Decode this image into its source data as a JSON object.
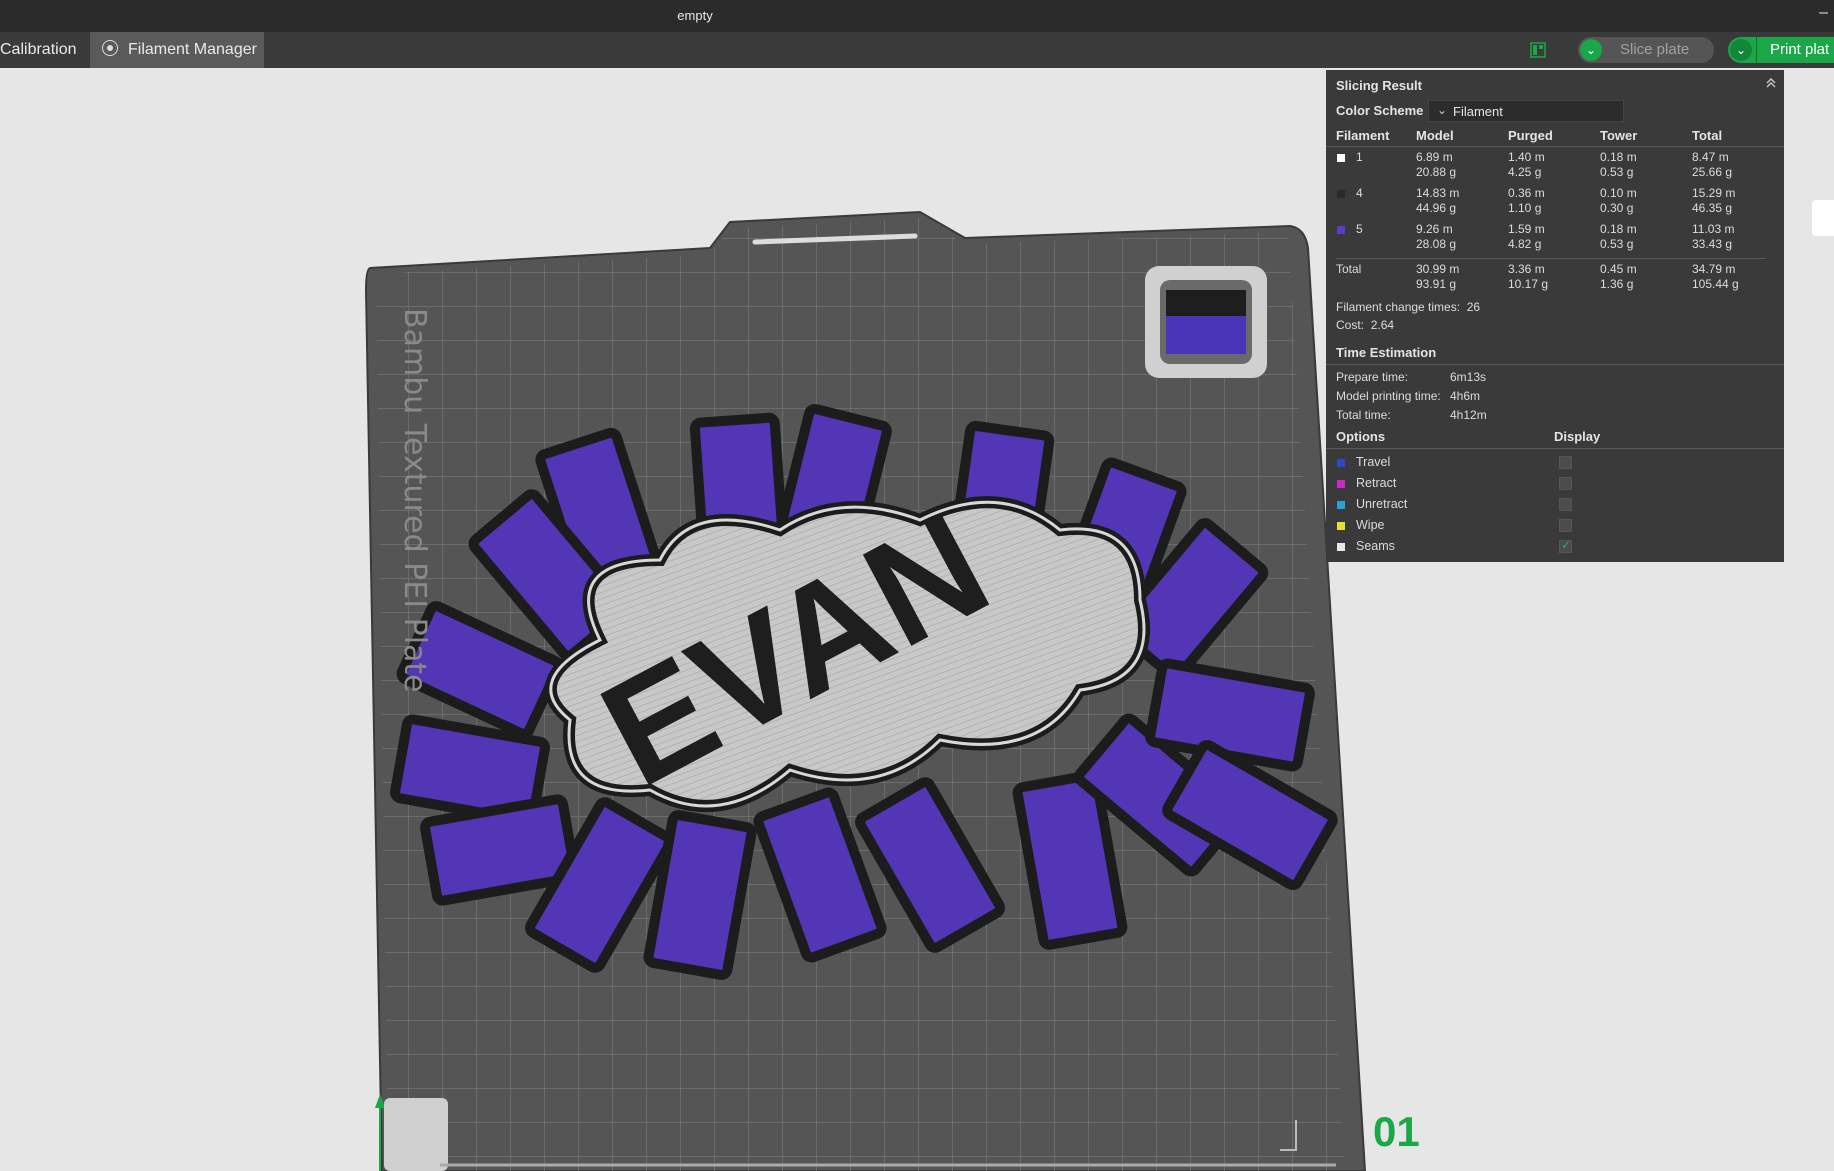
{
  "window": {
    "title": "empty"
  },
  "toolbar": {
    "calibration_label": "Calibration",
    "filament_manager_label": "Filament Manager",
    "slice_label": "Slice plate",
    "print_label": "Print plat"
  },
  "viewport": {
    "plate_name": "Bambu Textured PEI Plate",
    "model_text": "EVAN",
    "plate_number": "01"
  },
  "slicing": {
    "title": "Slicing Result",
    "color_scheme_label": "Color Scheme",
    "color_scheme_value": "Filament",
    "headers": [
      "Filament",
      "Model",
      "Purged",
      "Tower",
      "Total"
    ],
    "rows": [
      {
        "id": "1",
        "color": "#ffffff",
        "model": [
          "6.89 m",
          "20.88 g"
        ],
        "purged": [
          "1.40 m",
          "4.25 g"
        ],
        "tower": [
          "0.18 m",
          "0.53 g"
        ],
        "total": [
          "8.47 m",
          "25.66 g"
        ]
      },
      {
        "id": "4",
        "color": "#2a2a2a",
        "model": [
          "14.83 m",
          "44.96 g"
        ],
        "purged": [
          "0.36 m",
          "1.10 g"
        ],
        "tower": [
          "0.10 m",
          "0.30 g"
        ],
        "total": [
          "15.29 m",
          "46.35 g"
        ]
      },
      {
        "id": "5",
        "color": "#5a3cc8",
        "model": [
          "9.26 m",
          "28.08 g"
        ],
        "purged": [
          "1.59 m",
          "4.82 g"
        ],
        "tower": [
          "0.18 m",
          "0.53 g"
        ],
        "total": [
          "11.03 m",
          "33.43 g"
        ]
      }
    ],
    "total_row": {
      "label": "Total",
      "model": [
        "30.99 m",
        "93.91 g"
      ],
      "purged": [
        "3.36 m",
        "10.17 g"
      ],
      "tower": [
        "0.45 m",
        "1.36 g"
      ],
      "total": [
        "34.79 m",
        "105.44 g"
      ]
    },
    "filament_change_label": "Filament change times:",
    "filament_change_value": "26",
    "cost_label": "Cost:",
    "cost_value": "2.64",
    "time_title": "Time Estimation",
    "prepare_label": "Prepare time:",
    "prepare_value": "6m13s",
    "model_time_label": "Model printing time:",
    "model_time_value": "4h6m",
    "total_time_label": "Total time:",
    "total_time_value": "4h12m",
    "options_label": "Options",
    "display_label": "Display",
    "options": [
      {
        "label": "Travel",
        "color": "#2a4cc8",
        "checked": false
      },
      {
        "label": "Retract",
        "color": "#c82ac8",
        "checked": false
      },
      {
        "label": "Unretract",
        "color": "#2aa0d8",
        "checked": false
      },
      {
        "label": "Wipe",
        "color": "#e8e02a",
        "checked": false
      },
      {
        "label": "Seams",
        "color": "#e8e8e8",
        "checked": true
      }
    ]
  }
}
